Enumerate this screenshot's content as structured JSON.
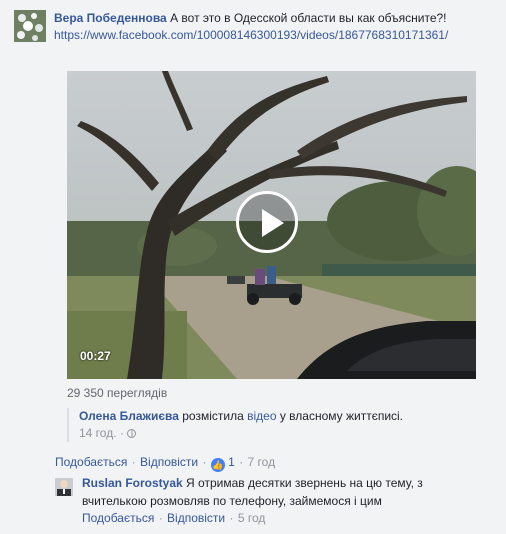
{
  "comment": {
    "author": "Вера Победеннова",
    "text": "А вот это в Одесской области вы как объясните?!",
    "url": "https://www.facebook.com/100008146300193/videos/1867768310171361/"
  },
  "video": {
    "duration": "00:27",
    "views": "29 350 переглядів"
  },
  "share": {
    "author": "Олена Блажиєва",
    "action_text": "розмістила",
    "link_text": "відео",
    "suffix": "у власному життєписі.",
    "time": "14 год.",
    "separator": "·"
  },
  "comment_actions": {
    "like": "Подобається",
    "reply": "Відповісти",
    "like_count": "1",
    "time": "7 год",
    "separator": "·"
  },
  "reply": {
    "author": "Ruslan Forostyak",
    "text": "Я отримав десятки звернень на цю тему, з вчителькою розмовляв по телефону, займемося і цим",
    "like": "Подобається",
    "reply_label": "Відповісти",
    "time": "5 год",
    "separator": "·"
  }
}
